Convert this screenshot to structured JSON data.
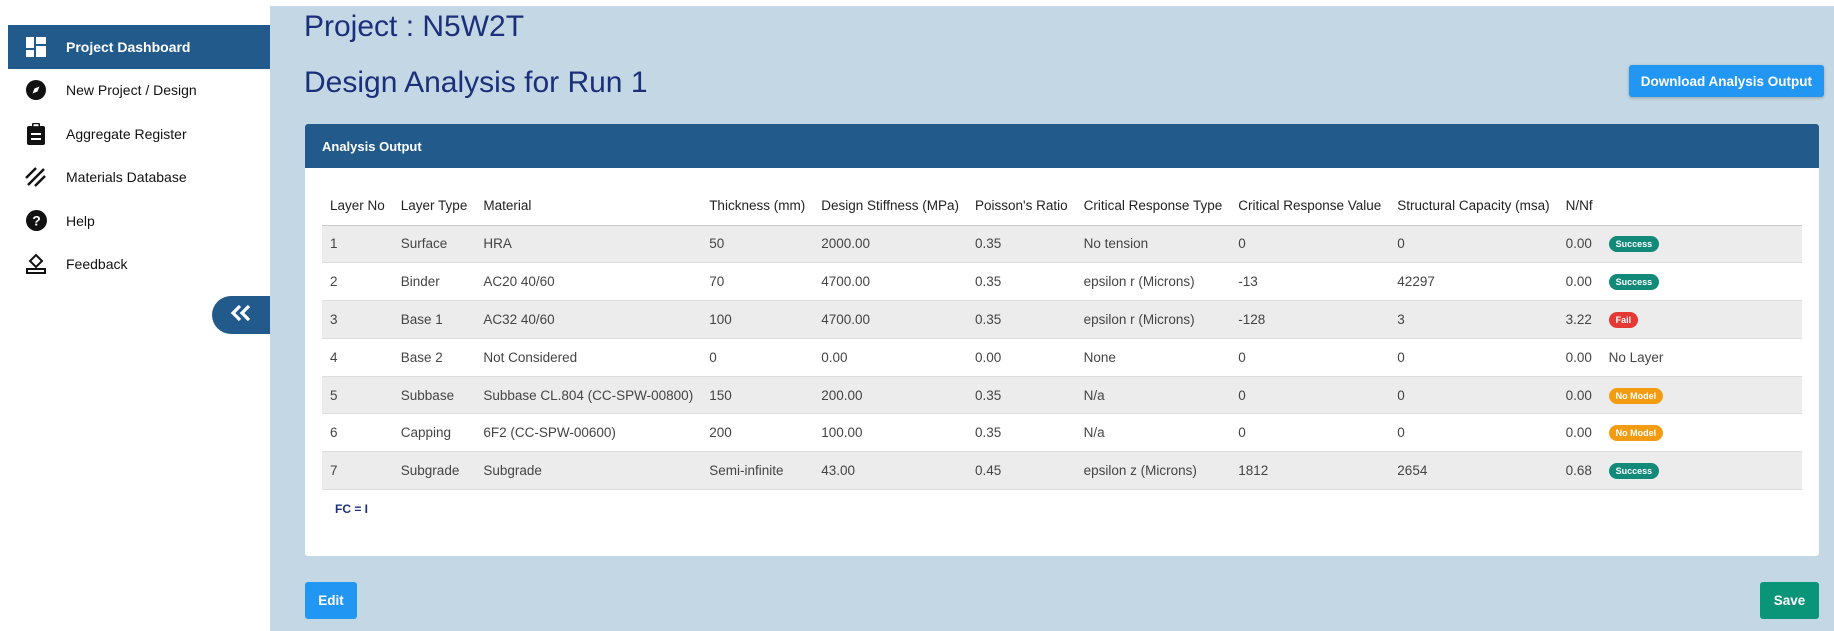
{
  "sidebar": {
    "items": [
      {
        "label": "Project Dashboard",
        "icon": "dashboard-icon",
        "active": true
      },
      {
        "label": "New Project / Design",
        "icon": "compass-icon"
      },
      {
        "label": "Aggregate Register",
        "icon": "clipboard-icon"
      },
      {
        "label": "Materials Database",
        "icon": "hatch-icon"
      },
      {
        "label": "Help",
        "icon": "help-icon"
      },
      {
        "label": "Feedback",
        "icon": "feedback-icon"
      }
    ],
    "collapse_icon": "double-chevron-left-icon"
  },
  "header": {
    "project_title": "Project : N5W2T",
    "run_title": "Design Analysis for Run 1",
    "download_label": "Download Analysis Output"
  },
  "card": {
    "title": "Analysis Output",
    "columns": [
      "Layer No",
      "Layer Type",
      "Material",
      "Thickness (mm)",
      "Design Stiffness (MPa)",
      "Poisson's Ratio",
      "Critical Response Type",
      "Critical Response Value",
      "Structural Capacity (msa)",
      "N/Nf",
      ""
    ],
    "rows": [
      [
        "1",
        "Surface",
        "HRA",
        "50",
        "2000.00",
        "0.35",
        "No tension",
        "0",
        "0",
        "0.00",
        "Success"
      ],
      [
        "2",
        "Binder",
        "AC20 40/60",
        "70",
        "4700.00",
        "0.35",
        "epsilon r (Microns)",
        "-13",
        "42297",
        "0.00",
        "Success"
      ],
      [
        "3",
        "Base 1",
        "AC32 40/60",
        "100",
        "4700.00",
        "0.35",
        "epsilon r (Microns)",
        "-128",
        "3",
        "3.22",
        "Fail"
      ],
      [
        "4",
        "Base 2",
        "Not Considered",
        "0",
        "0.00",
        "0.00",
        "None",
        "0",
        "0",
        "0.00",
        "No Layer"
      ],
      [
        "5",
        "Subbase",
        "Subbase CL.804 (CC-SPW-00800)",
        "150",
        "200.00",
        "0.35",
        "N/a",
        "0",
        "0",
        "0.00",
        "No Model"
      ],
      [
        "6",
        "Capping",
        "6F2 (CC-SPW-00600)",
        "200",
        "100.00",
        "0.35",
        "N/a",
        "0",
        "0",
        "0.00",
        "No Model"
      ],
      [
        "7",
        "Subgrade",
        "Subgrade",
        "Semi-infinite",
        "43.00",
        "0.45",
        "epsilon z (Microns)",
        "1812",
        "2654",
        "0.68",
        "Success"
      ]
    ],
    "fc_note": "FC = I"
  },
  "status_colors": {
    "Success": "#118a7a",
    "Fail": "#e53935",
    "No Model": "#f39c12"
  },
  "footer": {
    "edit_label": "Edit",
    "save_label": "Save"
  }
}
